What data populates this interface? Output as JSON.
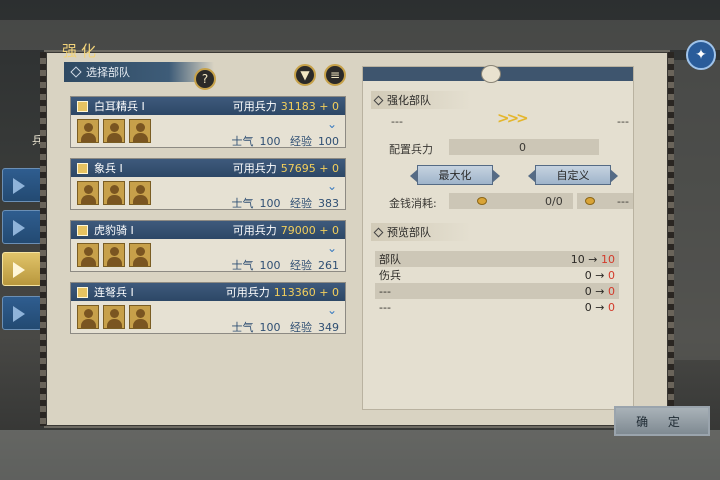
{
  "title": "强化",
  "side": {
    "label": "兵"
  },
  "left": {
    "section_title": "选择部队",
    "help_icon": "question-icon",
    "filter_icon": "filter-icon",
    "list_icon": "list-icon"
  },
  "units": [
    {
      "name": "白耳精兵 I",
      "power_label": "可用兵力",
      "power": "31183 + 0",
      "morale_label": "士气",
      "morale": "100",
      "exp_label": "经验",
      "exp": "100"
    },
    {
      "name": "象兵 I",
      "power_label": "可用兵力",
      "power": "57695 + 0",
      "morale_label": "士气",
      "morale": "100",
      "exp_label": "经验",
      "exp": "383"
    },
    {
      "name": "虎豹骑 I",
      "power_label": "可用兵力",
      "power": "79000 + 0",
      "morale_label": "士气",
      "morale": "100",
      "exp_label": "经验",
      "exp": "261"
    },
    {
      "name": "连弩兵 I",
      "power_label": "可用兵力",
      "power": "113360 + 0",
      "morale_label": "士气",
      "morale": "100",
      "exp_label": "经验",
      "exp": "349"
    }
  ],
  "right": {
    "strengthen_title": "强化部队",
    "from_dash": "---",
    "to_dash": "---",
    "config_label": "配置兵力",
    "config_value": "0",
    "max_button": "最大化",
    "custom_button": "自定义",
    "cost_label": "金钱消耗:",
    "cost_value": "0/0",
    "cost_extra": "---",
    "preview_title": "预览部队",
    "preview_rows": [
      {
        "label": "部队",
        "from": "10",
        "to": "10"
      },
      {
        "label": "伤兵",
        "from": "0",
        "to": "0"
      },
      {
        "label": "---",
        "from": "0",
        "to": "0"
      },
      {
        "label": "---",
        "from": "0",
        "to": "0"
      }
    ],
    "arrow": "→"
  },
  "confirm_label": "确 定",
  "colors": {
    "gold": "#f3cf5c",
    "panel": "#d9d3c2",
    "navy": "#2d4766",
    "red": "#d33a2a"
  }
}
